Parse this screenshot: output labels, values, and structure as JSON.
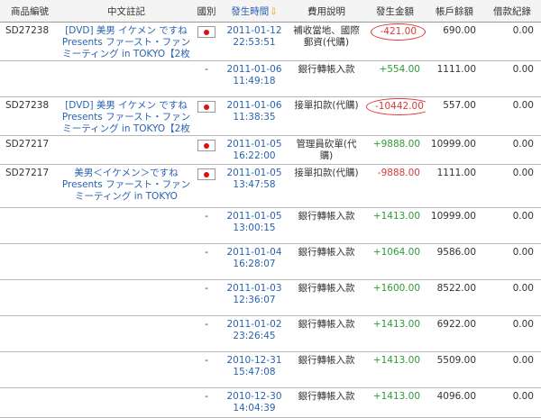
{
  "headers": {
    "id": "商品編號",
    "item": "中文註記",
    "country": "國別",
    "time": "發生時間",
    "desc": "費用說明",
    "amount": "發生金額",
    "balance": "帳戶餘額",
    "loan": "借款紀錄"
  },
  "icons": {
    "sort": "sort-down-arrow-icon",
    "flag": "japan-flag-icon"
  },
  "colors": {
    "positive": "#2c9c34",
    "negative": "#d63b3b",
    "highlight_circle": "#e03434",
    "link": "#2a63b0"
  },
  "rows": [
    {
      "id": "SD27238",
      "item_prefix": "[DVD]",
      "item_text": "美男 イケメン ですね Presents ファースト・ファンミーティング in TOKYO【2枚",
      "country_flag": true,
      "country_text": "",
      "date": "2011-01-12",
      "time": "22:53:51",
      "desc": "補收當地、國際郵資(代購)",
      "amount": "-421.00",
      "amount_sign": "neg",
      "circled": true,
      "balance": "690.00",
      "loan": "0.00"
    },
    {
      "id": "",
      "item_prefix": "",
      "item_text": "",
      "country_flag": false,
      "country_text": "-",
      "date": "2011-01-06",
      "time": "11:49:18",
      "desc": "銀行轉帳入款",
      "amount": "+554.00",
      "amount_sign": "pos",
      "circled": false,
      "balance": "1111.00",
      "loan": "0.00"
    },
    {
      "id": "SD27238",
      "item_prefix": "[DVD]",
      "item_text": "美男 イケメン ですね Presents ファースト・ファンミーティング in TOKYO【2枚",
      "country_flag": true,
      "country_text": "",
      "date": "2011-01-06",
      "time": "11:38:35",
      "desc": "接單扣款(代購)",
      "amount": "-10442.00",
      "amount_sign": "neg",
      "circled": true,
      "balance": "557.00",
      "loan": "0.00"
    },
    {
      "id": "SD27217",
      "item_prefix": "",
      "item_text": "",
      "country_flag": true,
      "country_text": "",
      "date": "2011-01-05",
      "time": "16:22:00",
      "desc": "管理員砍單(代購)",
      "amount": "+9888.00",
      "amount_sign": "pos",
      "circled": false,
      "balance": "10999.00",
      "loan": "0.00"
    },
    {
      "id": "SD27217",
      "item_prefix": "",
      "item_text": "美男＜イケメン＞ですね Presents ファースト・ファンミーティング in TOKYO",
      "country_flag": true,
      "country_text": "",
      "date": "2011-01-05",
      "time": "13:47:58",
      "desc": "接單扣款(代購)",
      "amount": "-9888.00",
      "amount_sign": "neg",
      "circled": false,
      "balance": "1111.00",
      "loan": "0.00"
    },
    {
      "id": "",
      "item_prefix": "",
      "item_text": "",
      "country_flag": false,
      "country_text": "-",
      "date": "2011-01-05",
      "time": "13:00:15",
      "desc": "銀行轉帳入款",
      "amount": "+1413.00",
      "amount_sign": "pos",
      "circled": false,
      "balance": "10999.00",
      "loan": "0.00"
    },
    {
      "id": "",
      "item_prefix": "",
      "item_text": "",
      "country_flag": false,
      "country_text": "-",
      "date": "2011-01-04",
      "time": "16:28:07",
      "desc": "銀行轉帳入款",
      "amount": "+1064.00",
      "amount_sign": "pos",
      "circled": false,
      "balance": "9586.00",
      "loan": "0.00"
    },
    {
      "id": "",
      "item_prefix": "",
      "item_text": "",
      "country_flag": false,
      "country_text": "-",
      "date": "2011-01-03",
      "time": "12:36:07",
      "desc": "銀行轉帳入款",
      "amount": "+1600.00",
      "amount_sign": "pos",
      "circled": false,
      "balance": "8522.00",
      "loan": "0.00"
    },
    {
      "id": "",
      "item_prefix": "",
      "item_text": "",
      "country_flag": false,
      "country_text": "-",
      "date": "2011-01-02",
      "time": "23:26:45",
      "desc": "銀行轉帳入款",
      "amount": "+1413.00",
      "amount_sign": "pos",
      "circled": false,
      "balance": "6922.00",
      "loan": "0.00"
    },
    {
      "id": "",
      "item_prefix": "",
      "item_text": "",
      "country_flag": false,
      "country_text": "-",
      "date": "2010-12-31",
      "time": "15:47:08",
      "desc": "銀行轉帳入款",
      "amount": "+1413.00",
      "amount_sign": "pos",
      "circled": false,
      "balance": "5509.00",
      "loan": "0.00"
    },
    {
      "id": "",
      "item_prefix": "",
      "item_text": "",
      "country_flag": false,
      "country_text": "-",
      "date": "2010-12-30",
      "time": "14:04:39",
      "desc": "銀行轉帳入款",
      "amount": "+1413.00",
      "amount_sign": "pos",
      "circled": false,
      "balance": "4096.00",
      "loan": "0.00"
    }
  ]
}
